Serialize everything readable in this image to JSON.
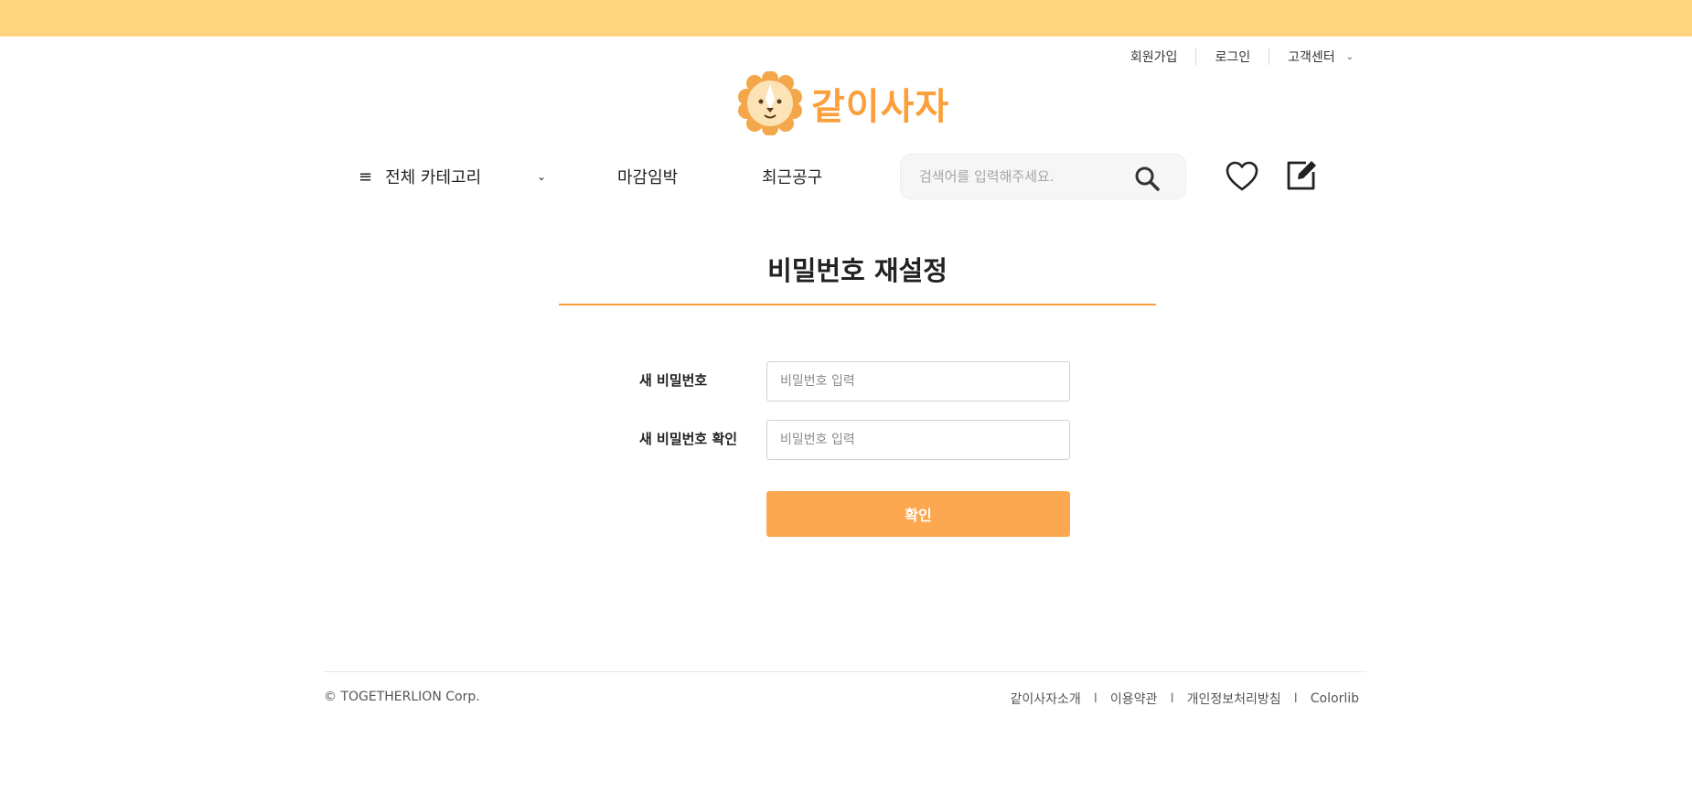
{
  "util_nav": {
    "signup": "회원가입",
    "login": "로그인",
    "support": "고객센터",
    "support_chevron": "chevron-down-icon"
  },
  "brand": {
    "name": "같이사자",
    "logo_icon": "lion-logo-icon",
    "accent_color": "#fb9f3b"
  },
  "main_nav": {
    "category_icon": "hamburger-menu-icon",
    "category_label": "전체 카테고리",
    "category_chevron": "chevron-down-icon",
    "item_closing": "마감임박",
    "item_recent": "최근공구",
    "search_placeholder": "검색어를 입력해주세요.",
    "search_icon": "search-icon",
    "wishlist_icon": "heart-icon",
    "write_icon": "edit-icon"
  },
  "reset_form": {
    "title": "비밀번호 재설정",
    "new_password_label": "새 비밀번호",
    "new_password_placeholder": "비밀번호 입력",
    "confirm_password_label": "새 비밀번호 확인",
    "confirm_password_placeholder": "비밀번호 입력",
    "submit_label": "확인",
    "submit_color": "#fca850"
  },
  "footer": {
    "copyright": "© TOGETHERLION Corp.",
    "links": [
      "같이사자소개",
      "이용약관",
      "개인정보처리방침",
      "Colorlib"
    ],
    "separator": "I"
  },
  "colors": {
    "topbar": "#ffd47f",
    "accent": "#fb9f3b"
  }
}
